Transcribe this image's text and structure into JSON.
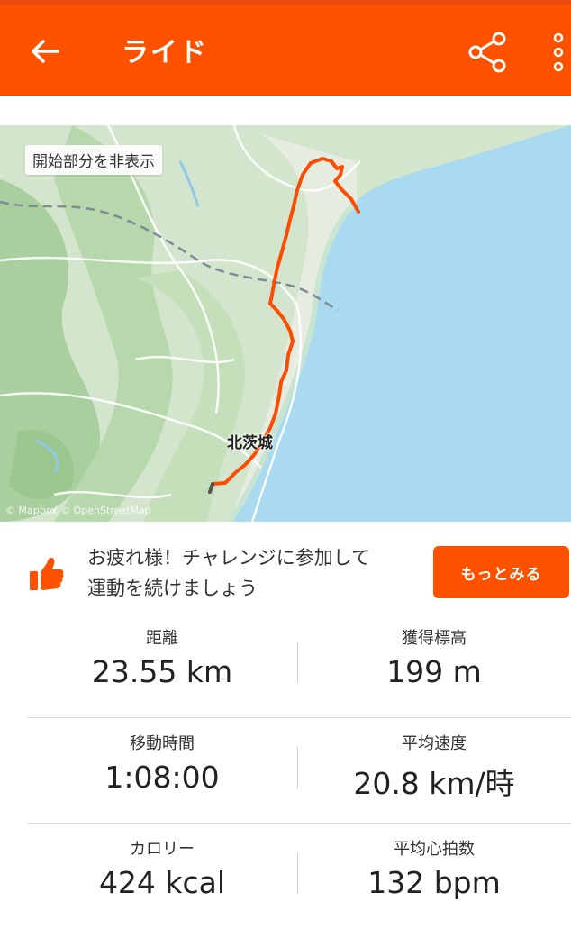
{
  "app_bar": {
    "title": "ライド",
    "back_icon": "back-arrow-icon",
    "share_icon": "share-icon",
    "more_icon": "more-vertical-icon",
    "color": "#fc5200"
  },
  "map": {
    "hide_start_label": "開始部分を非表示",
    "place_label": "北茨城",
    "attribution": "© Mapbox © OpenStreetMap",
    "route_color": "#fc4c02"
  },
  "promo": {
    "icon": "thumbs-up-icon",
    "message_line1": "お疲れ様！チャレンジに参加して",
    "message_line2": "運動を続けましょう",
    "button_label": "もっとみる"
  },
  "stats": [
    {
      "left": {
        "label": "距離",
        "value": "23.55 km"
      },
      "right": {
        "label": "獲得標高",
        "value": "199 m"
      }
    },
    {
      "left": {
        "label": "移動時間",
        "value": "1:08:00"
      },
      "right": {
        "label": "平均速度",
        "value": "20.8 km/時"
      }
    },
    {
      "left": {
        "label": "カロリー",
        "value": "424 kcal"
      },
      "right": {
        "label": "平均心拍数",
        "value": "132 bpm"
      }
    }
  ]
}
